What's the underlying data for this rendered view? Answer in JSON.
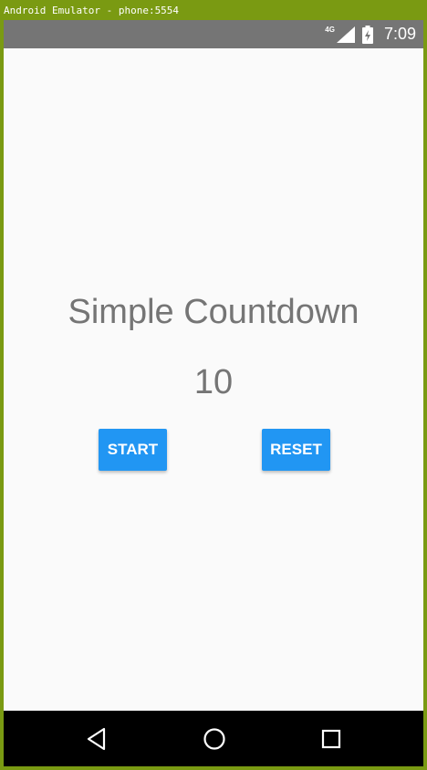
{
  "emulator": {
    "title": "Android Emulator - phone:5554"
  },
  "status_bar": {
    "network": "4G",
    "time": "7:09",
    "icons": [
      "signal-icon",
      "battery-icon"
    ]
  },
  "app": {
    "title": "Simple Countdown",
    "counter": "10",
    "start_label": "START",
    "reset_label": "RESET"
  },
  "nav_bar": {
    "icons": [
      "back-icon",
      "home-icon",
      "recent-apps-icon"
    ]
  },
  "colors": {
    "emulator_frame": "#7a9a12",
    "status_bar": "#757575",
    "background": "#fafafa",
    "text": "#757575",
    "button": "#2196f3",
    "nav_bar": "#000000"
  }
}
